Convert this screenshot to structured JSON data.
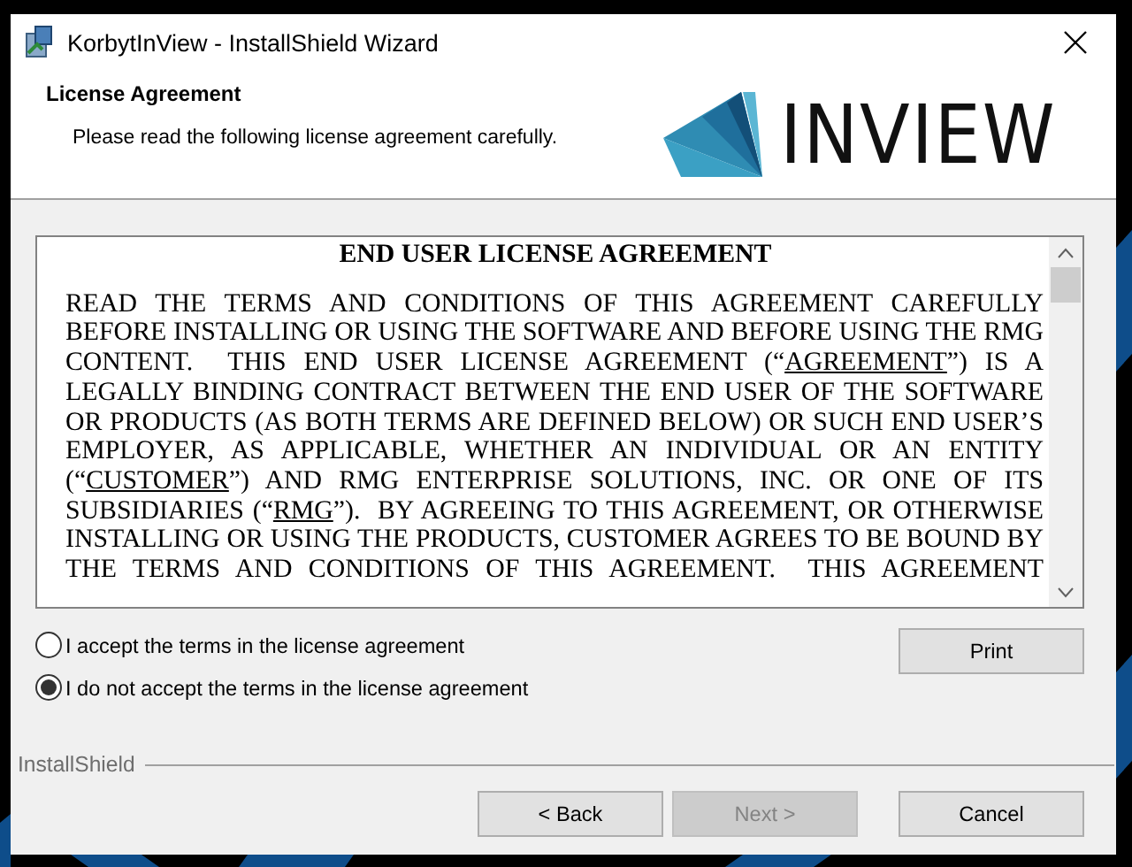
{
  "window": {
    "title": "KorbytInView - InstallShield Wizard"
  },
  "header": {
    "title": "License Agreement",
    "subtitle": "Please read the following license agreement carefully.",
    "logo_text": "INVIEW"
  },
  "license": {
    "heading": "END USER LICENSE AGREEMENT",
    "paragraph": [
      {
        "text": "READ THE TERMS AND CONDITIONS OF THIS AGREEMENT CAREFULLY BEFORE INSTALLING OR USING THE SOFTWARE AND BEFORE USING THE RMG CONTENT.  THIS END USER LICENSE AGREEMENT (“",
        "underlined": false
      },
      {
        "text": "AGREEMENT",
        "underlined": true
      },
      {
        "text": "”) IS A LEGALLY BINDING CONTRACT BETWEEN THE END USER OF THE SOFTWARE OR PRODUCTS (AS BOTH TERMS ARE DEFINED BELOW) OR SUCH END USER’S EMPLOYER, AS APPLICABLE, WHETHER AN INDIVIDUAL OR AN ENTITY (“",
        "underlined": false
      },
      {
        "text": "CUSTOMER",
        "underlined": true
      },
      {
        "text": "”) AND RMG ENTERPRISE SOLUTIONS, INC. OR ONE OF ITS SUBSIDIARIES (“",
        "underlined": false
      },
      {
        "text": "RMG",
        "underlined": true
      },
      {
        "text": "”).  BY AGREEING TO THIS AGREEMENT, OR OTHERWISE INSTALLING OR USING THE PRODUCTS, CUSTOMER AGREES TO BE BOUND BY THE TERMS AND CONDITIONS OF THIS AGREEMENT.  THIS AGREEMENT",
        "underlined": false
      }
    ]
  },
  "options": [
    {
      "label": "I accept the terms in the license agreement",
      "selected": false
    },
    {
      "label": "I do not accept the terms in the license agreement",
      "selected": true
    }
  ],
  "print_button": {
    "label": "Print",
    "disabled": false
  },
  "footer": {
    "brand": "InstallShield"
  },
  "buttons": [
    {
      "label": "< Back",
      "disabled": false
    },
    {
      "label": "Next >",
      "disabled": true
    },
    {
      "label": "Cancel",
      "disabled": false
    }
  ]
}
